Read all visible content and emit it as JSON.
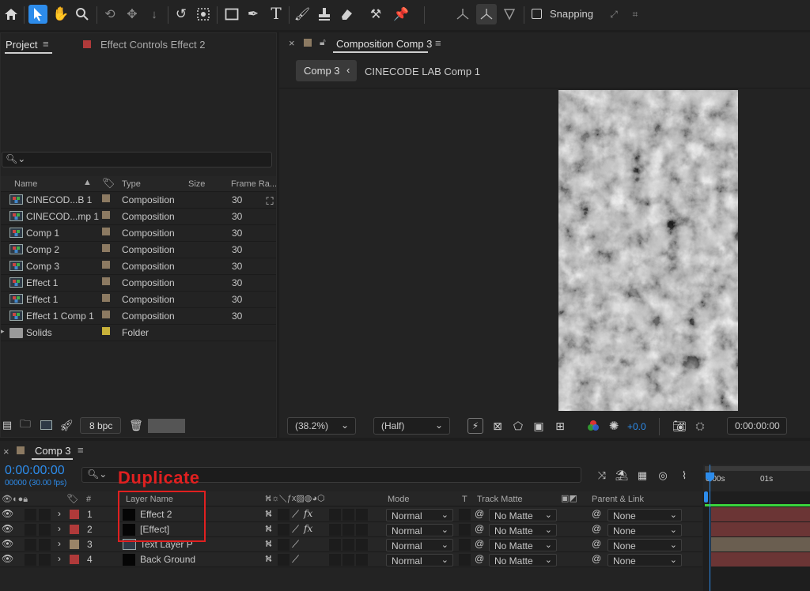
{
  "toolbar": {
    "snapping_label": "Snapping"
  },
  "project": {
    "tab_project": "Project",
    "tab_effect_controls": "Effect Controls Effect 2",
    "columns": {
      "name": "Name",
      "type": "Type",
      "size": "Size",
      "frame_rate": "Frame Ra..."
    },
    "items": [
      {
        "name": "CINECOD...B 1",
        "type": "Composition",
        "fps": "30",
        "color": "#8c7a62"
      },
      {
        "name": "CINECOD...mp 1",
        "type": "Composition",
        "fps": "30",
        "color": "#8c7a62"
      },
      {
        "name": "Comp 1",
        "type": "Composition",
        "fps": "30",
        "color": "#8c7a62"
      },
      {
        "name": "Comp 2",
        "type": "Composition",
        "fps": "30",
        "color": "#8c7a62"
      },
      {
        "name": "Comp 3",
        "type": "Composition",
        "fps": "30",
        "color": "#8c7a62"
      },
      {
        "name": "Effect 1",
        "type": "Composition",
        "fps": "30",
        "color": "#8c7a62"
      },
      {
        "name": "Effect 1",
        "type": "Composition",
        "fps": "30",
        "color": "#8c7a62"
      },
      {
        "name": "Effect 1 Comp 1",
        "type": "Composition",
        "fps": "30",
        "color": "#8c7a62"
      },
      {
        "name": "Solids",
        "type": "Folder",
        "fps": "",
        "color": "#c8b23a"
      }
    ],
    "bpc": "8 bpc"
  },
  "composition": {
    "tab_title": "Composition Comp 3",
    "breadcrumb": [
      "Comp 3",
      "CINECODE LAB Comp 1"
    ],
    "zoom": "(38.2%)",
    "resolution": "(Half)",
    "exposure": "+0.0",
    "timecode": "0:00:00:00"
  },
  "timeline": {
    "tab": "Comp 3",
    "timecode": "0:00:00:00",
    "frames": "00000 (30.00 fps)",
    "annotation": "Duplicate",
    "columns": {
      "num": "#",
      "layer_name": "Layer Name",
      "mode": "Mode",
      "t": "T",
      "track_matte": "Track Matte",
      "parent": "Parent & Link"
    },
    "ruler": {
      "start": "0:00s",
      "one": "01s"
    },
    "layers": [
      {
        "num": "1",
        "name": "Effect 2",
        "mode": "Normal",
        "matte": "No Matte",
        "parent": "None",
        "color": "#b03a3a",
        "fx": true,
        "bar": "#6b3535"
      },
      {
        "num": "2",
        "name": "[Effect]",
        "mode": "Normal",
        "matte": "No Matte",
        "parent": "None",
        "color": "#b03a3a",
        "fx": true,
        "bar": "#6b3535"
      },
      {
        "num": "3",
        "name": "Text Layer P",
        "mode": "Normal",
        "matte": "No Matte",
        "parent": "None",
        "color": "#9a8468",
        "fx": false,
        "bar": "#6a5e50"
      },
      {
        "num": "4",
        "name": "Back Ground",
        "mode": "Normal",
        "matte": "No Matte",
        "parent": "None",
        "color": "#b03a3a",
        "fx": false,
        "bar": "#6b3535"
      }
    ]
  },
  "colors": {
    "accent": "#2d8ceb",
    "annotation": "#e02020"
  }
}
